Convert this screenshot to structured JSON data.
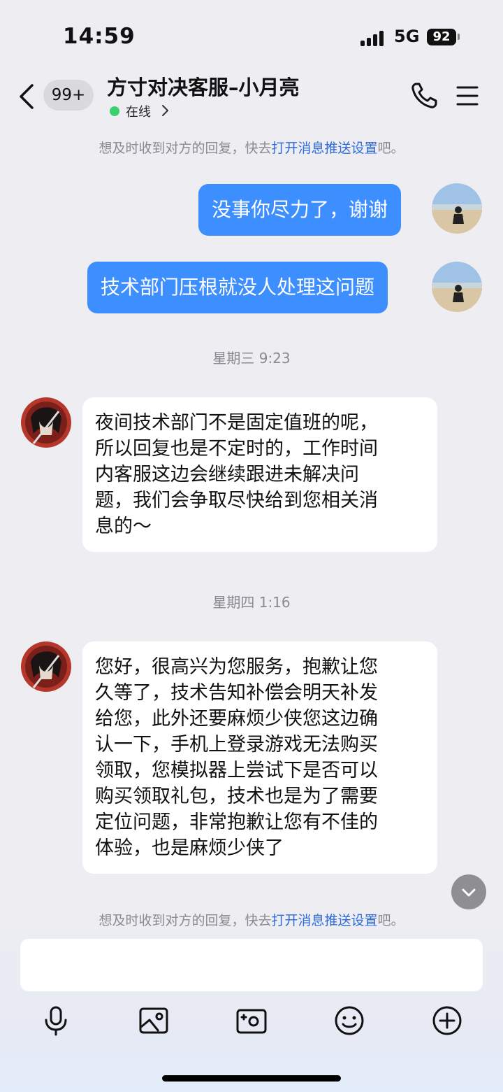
{
  "status": {
    "time": "14:59",
    "network": "5G",
    "battery": "92"
  },
  "header": {
    "unread_count": "99+",
    "title": "方寸对决客服–小月亮",
    "online": "在线"
  },
  "hints": [
    {
      "prefix": "想及时收到对方的回复，快去",
      "link": "打开消息推送设置",
      "suffix": "吧。"
    },
    {
      "prefix": "想及时收到对方的回复，快去",
      "link": "打开消息推送设置",
      "suffix": "吧。"
    }
  ],
  "messages": [
    {
      "from": "me",
      "text": "没事你尽力了，谢谢"
    },
    {
      "from": "me",
      "text": "技术部门压根就没人处理这问题"
    },
    {
      "timestamp": "星期三 9:23"
    },
    {
      "from": "agent",
      "lines": [
        "夜间技术部门不是固定值班的呢，",
        "所以回复也是不定时的，工作时间",
        "内客服这边会继续跟进未解决问",
        "题，我们会争取尽快给到您相关消",
        "息的～"
      ]
    },
    {
      "timestamp": "星期四 1:16"
    },
    {
      "from": "agent",
      "lines": [
        "您好，很高兴为您服务，抱歉让您",
        "久等了，技术告知补偿会明天补发",
        "给您，此外还要麻烦少侠您这边确",
        "认一下，手机上登录游戏无法购买",
        "领取，您模拟器上尝试下是否可以",
        "购买领取礼包，技术也是为了需要",
        "定位问题，非常抱歉让您有不佳的",
        "体验，也是麻烦少侠了"
      ]
    }
  ],
  "composer": {
    "tools": [
      "microphone-icon",
      "image-icon",
      "camera-icon",
      "emoji-icon",
      "plus-icon"
    ]
  },
  "colors": {
    "outgoing_bubble": "#3D8EFF",
    "link": "#2F6BD9",
    "online": "#3BD16F"
  }
}
